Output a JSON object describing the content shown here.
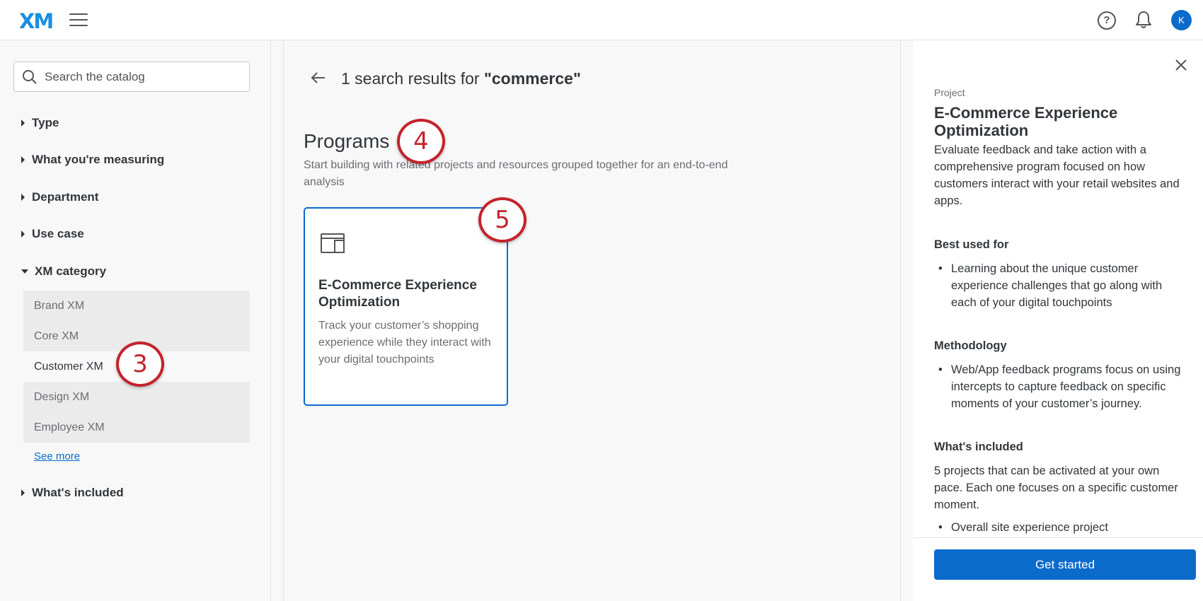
{
  "app": {
    "logo": "XM",
    "avatar_initial": "K"
  },
  "sidebar": {
    "search_placeholder": "Search the catalog",
    "facets": [
      {
        "label": "Type"
      },
      {
        "label": "What you're measuring"
      },
      {
        "label": "Department"
      },
      {
        "label": "Use case"
      },
      {
        "label": "XM category"
      },
      {
        "label": "What's included"
      }
    ],
    "xm_categories": [
      "Brand XM",
      "Core XM",
      "Customer XM",
      "Design XM",
      "Employee XM"
    ],
    "selected_category": "Customer XM",
    "see_more": "See more"
  },
  "main": {
    "results_prefix": "1 search results for ",
    "query": "\"commerce\"",
    "section_title": "Programs",
    "section_desc": "Start building with related projects and resources grouped together for an end-to-end analysis",
    "card": {
      "title": "E-Commerce Experience Optimization",
      "description": "Track your customer’s shopping experience while they interact with your digital touchpoints"
    }
  },
  "panel": {
    "type": "Project",
    "title": "E-Commerce Experience Optimization",
    "description": "Evaluate feedback and take action with a comprehensive program focused on how customers interact with your retail websites and apps.",
    "best_used_for_heading": "Best used for",
    "best_used_for": [
      "Learning about the unique customer experience challenges that go along with each of your digital touchpoints"
    ],
    "methodology_heading": "Methodology",
    "methodology": [
      "Web/App feedback programs focus on using intercepts to capture feedback on specific moments of your customer’s journey."
    ],
    "included_heading": "What's included",
    "included_text": "5 projects that can be activated at your own pace. Each one focuses on a specific customer moment.",
    "included_items": [
      "Overall site experience project"
    ],
    "cta": "Get started"
  },
  "callouts": [
    "3",
    "4",
    "5"
  ],
  "colors": {
    "accent": "#0b6bcb",
    "callout": "#c4232b",
    "logo": "#1a8fe0"
  },
  "icons": {
    "menu": "hamburger-icon",
    "help": "help-icon",
    "bell": "bell-icon",
    "search": "search-icon",
    "back": "arrow-left-icon",
    "close": "close-icon",
    "program": "browser-window-icon"
  }
}
